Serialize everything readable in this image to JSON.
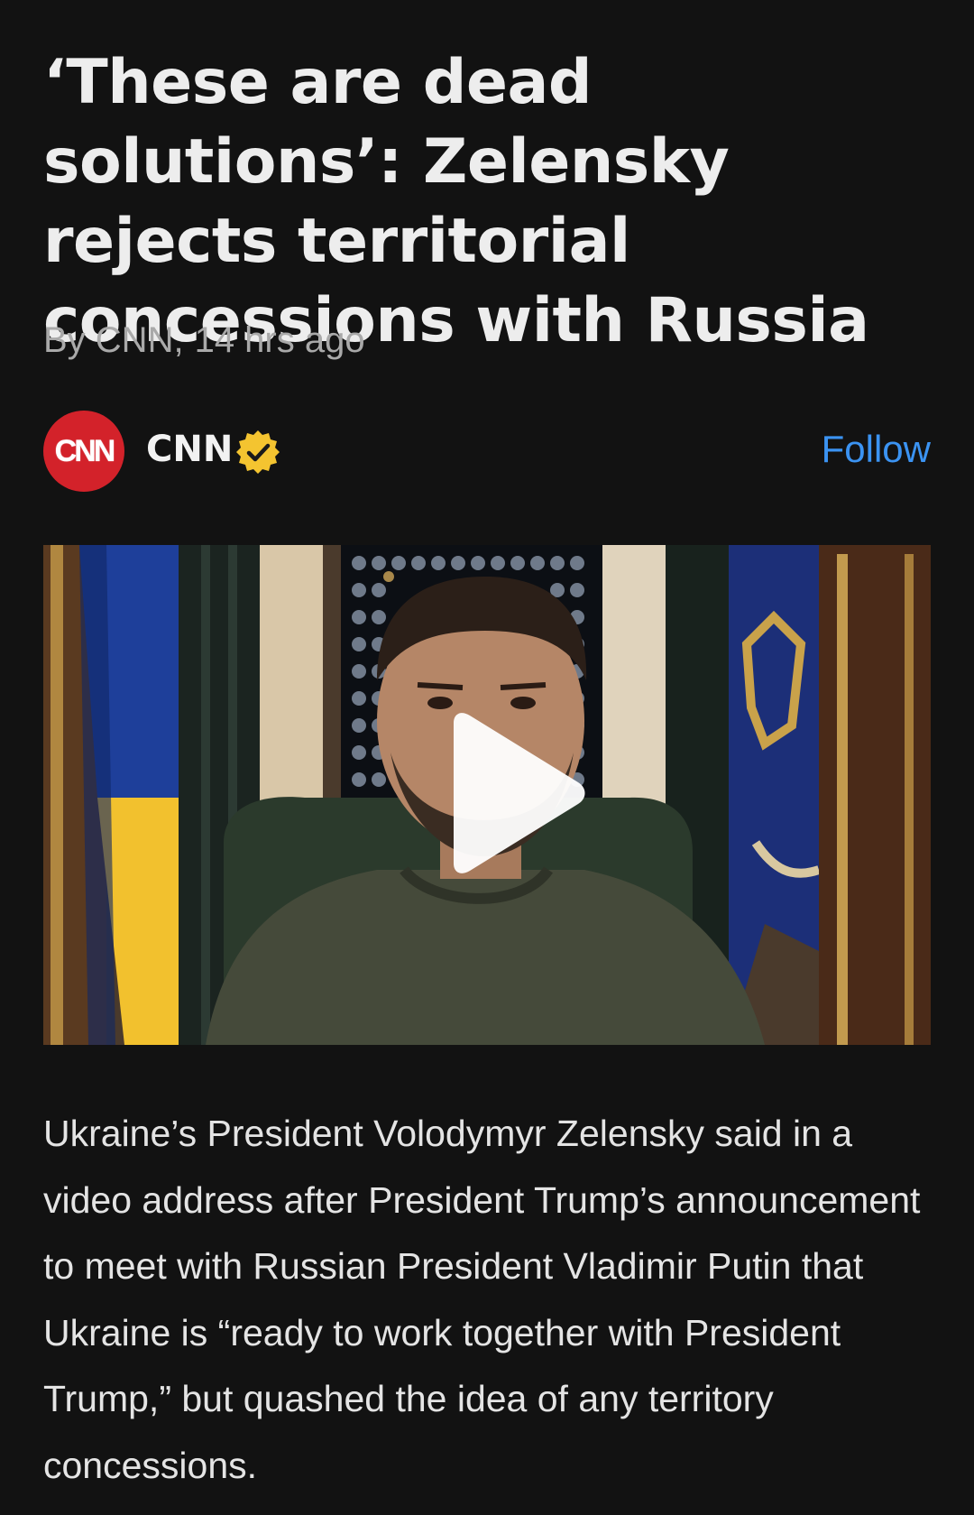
{
  "article": {
    "headline": "‘These are dead solutions’: Zelensky rejects territorial concessions with Russia",
    "byline_author": "By CNN,",
    "byline_time": "14 hrs ago",
    "body": "Ukraine’s President Volodymyr Zelensky said in a video address after President Trump’s announcement to meet with Russian President Vladimir Putin that Ukraine is “ready to work together with President Trump,” but quashed the idea of any territory concessions."
  },
  "source": {
    "logo_text": "CNN",
    "name": "CNN",
    "verified_icon": "verified-badge-icon",
    "follow_label": "Follow"
  },
  "video": {
    "play_icon": "play-icon"
  },
  "colors": {
    "background": "#121212",
    "accent_link": "#3b93f2",
    "logo_red": "#d3222a",
    "badge_yellow": "#f4c430"
  }
}
